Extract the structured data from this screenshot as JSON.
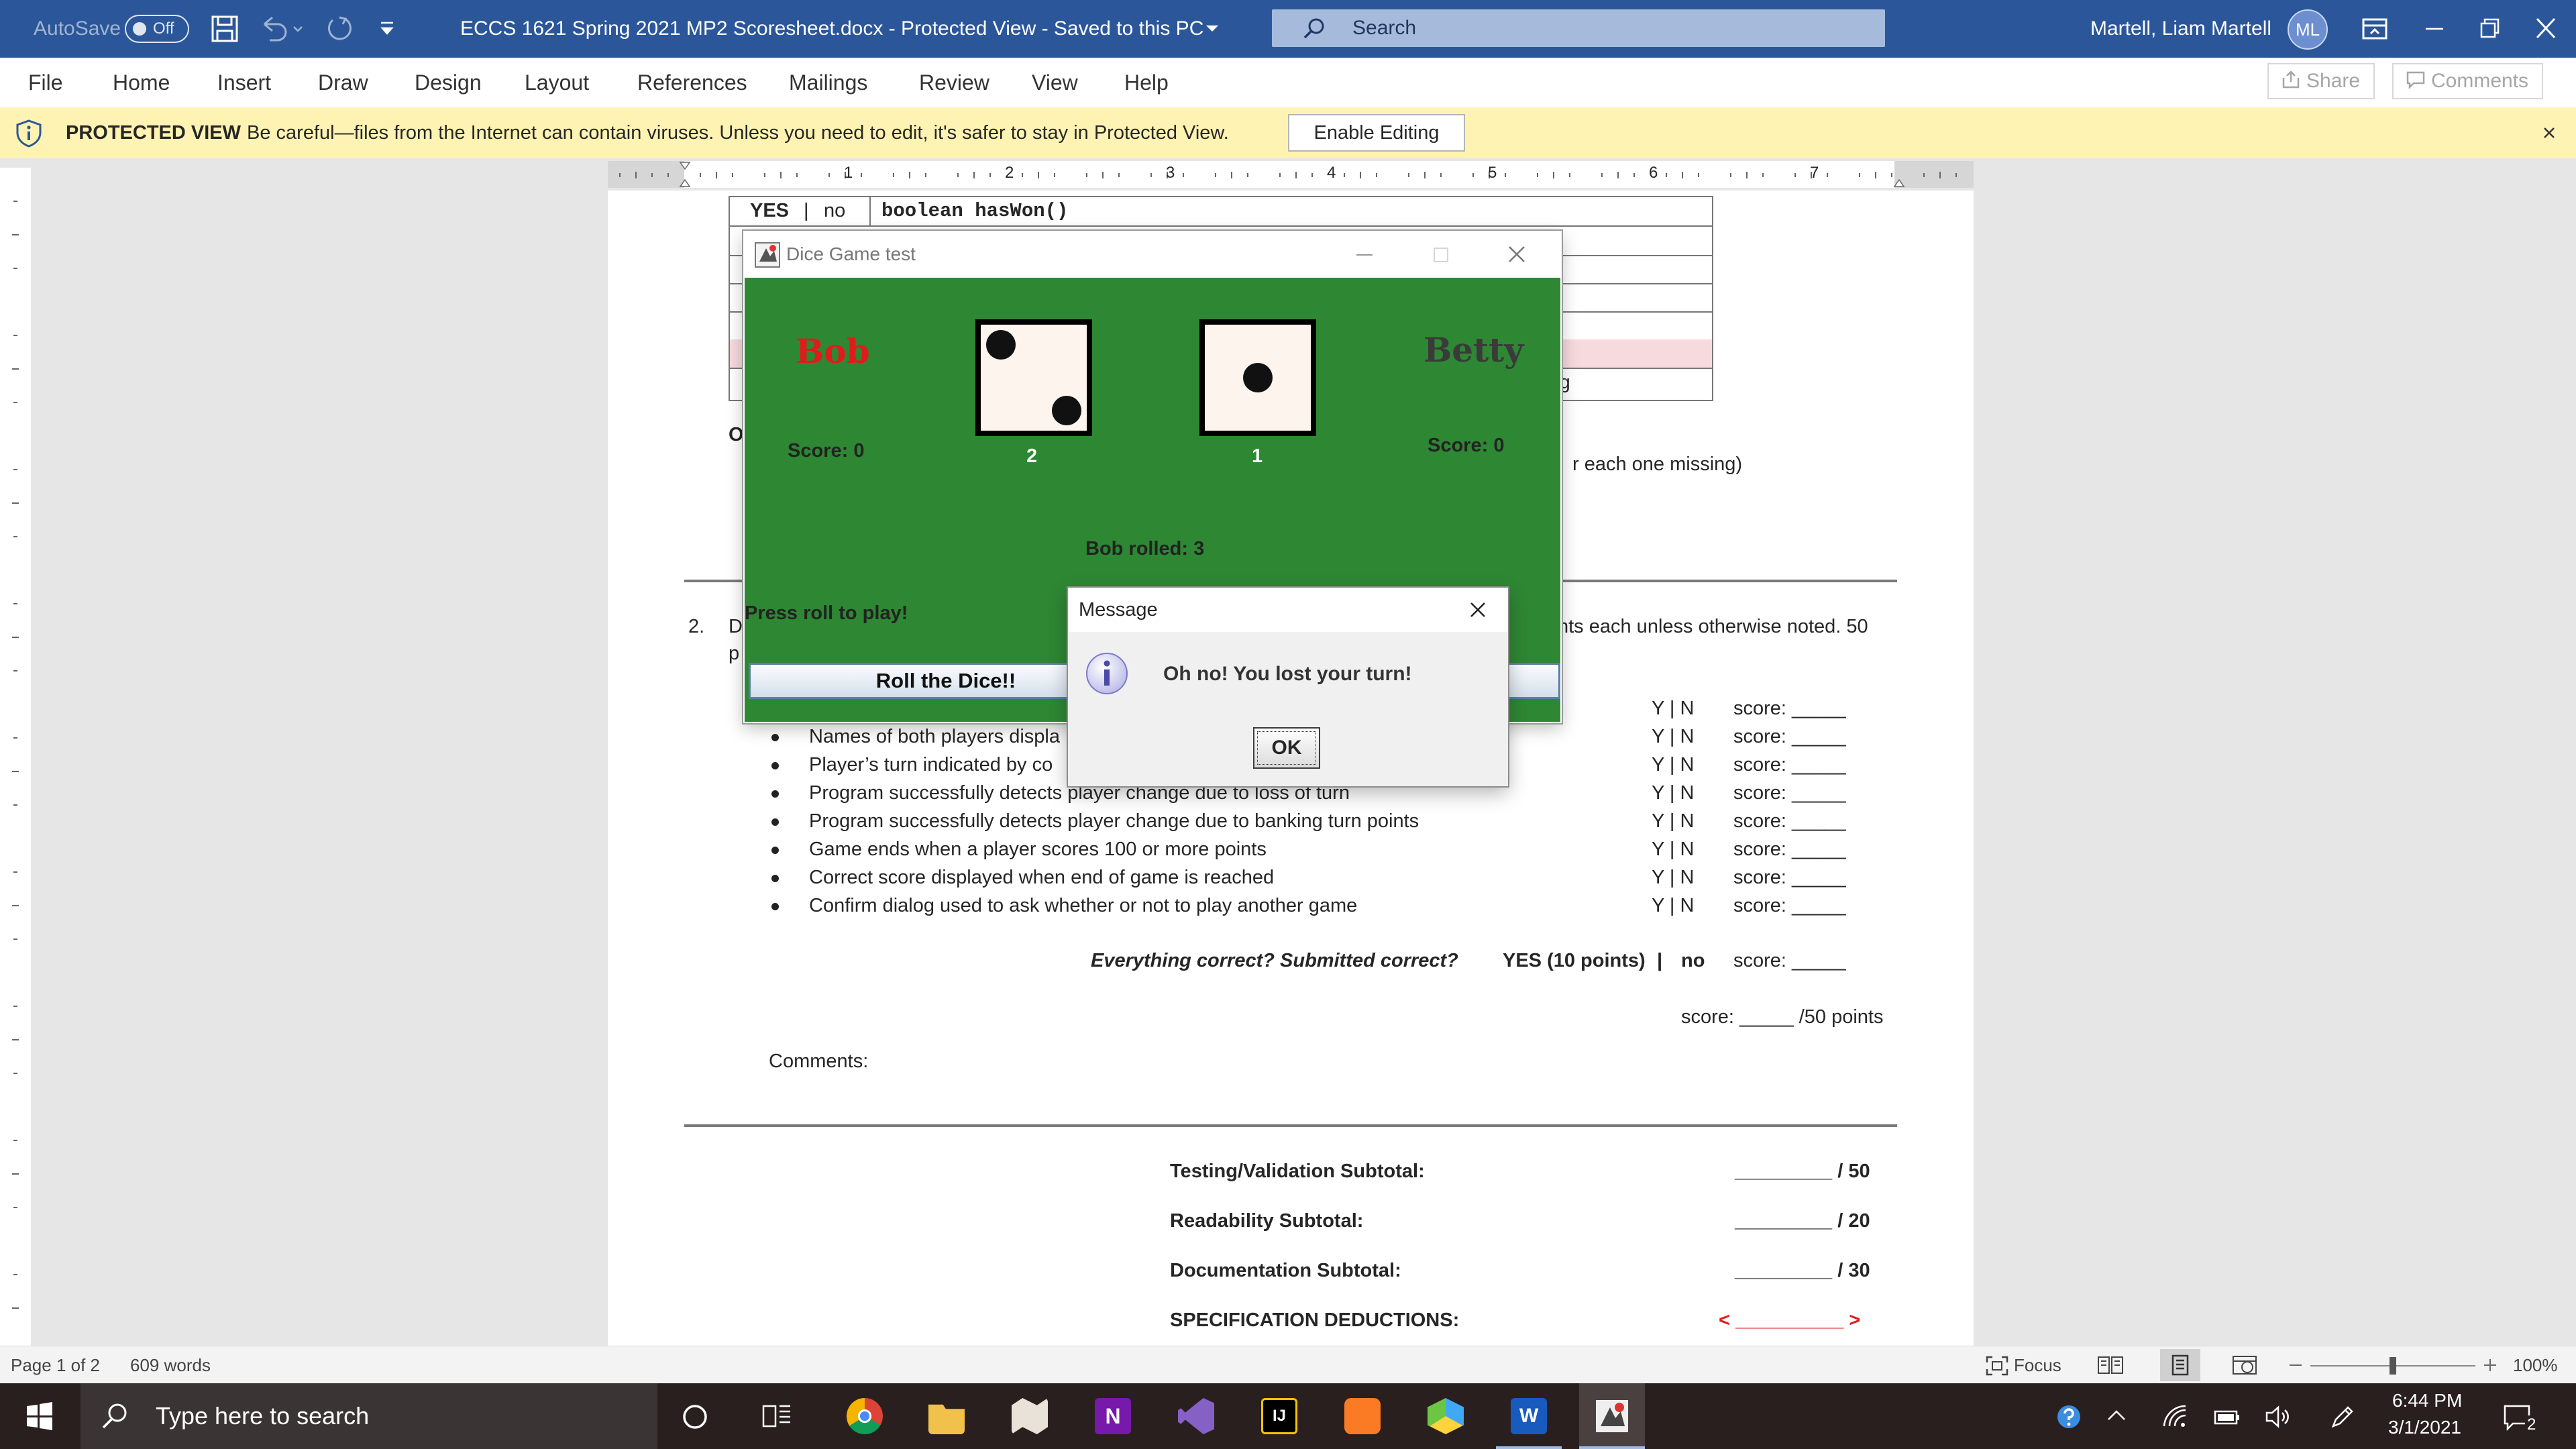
{
  "titlebar": {
    "autosave_label": "AutoSave",
    "autosave_state": "Off",
    "title": "ECCS 1621 Spring 2021 MP2 Scoresheet.docx  -  Protected View  -  Saved to this PC",
    "search_placeholder": "Search",
    "user_name": "Martell, Liam Martell",
    "user_initials": "ML",
    "accent_color": "#2b579a"
  },
  "ribbon": {
    "tabs": [
      "File",
      "Home",
      "Insert",
      "Draw",
      "Design",
      "Layout",
      "References",
      "Mailings",
      "Review",
      "View",
      "Help"
    ],
    "share_label": "Share",
    "comments_label": "Comments"
  },
  "protected_bar": {
    "title": "PROTECTED VIEW",
    "message": "Be careful—files from the Internet can contain viruses. Unless you need to edit, it's safer to stay in Protected View.",
    "enable_button": "Enable Editing"
  },
  "ruler": {
    "numbers": [
      "1",
      "2",
      "3",
      "4",
      "5",
      "6",
      "7"
    ]
  },
  "document": {
    "table_row": {
      "yes": "YES",
      "sep": "|",
      "no": "no",
      "method": "boolean hasWon()"
    },
    "clipped_row_text": "ing",
    "clipped_o": "O",
    "clipped_missing": "r each one missing)",
    "section2_num": "2.",
    "section2_start": "D",
    "section2_second": "p",
    "section2_tail": "nts each unless otherwise noted. 50",
    "items": [
      {
        "text": "",
        "yn": "Y | N",
        "score": "score: _____"
      },
      {
        "text": "Names of both players displa",
        "yn": "Y | N",
        "score": "score: _____"
      },
      {
        "text": "Player’s turn indicated by co",
        "yn": "Y | N",
        "score": "score: _____"
      },
      {
        "text": "Program successfully detects player change due to loss of turn",
        "yn": "Y | N",
        "score": "score: _____"
      },
      {
        "text": "Program successfully detects player change due to banking turn points",
        "yn": "Y | N",
        "score": "score: _____"
      },
      {
        "text": "Game ends when a player scores 100 or more points",
        "yn": "Y | N",
        "score": "score: _____"
      },
      {
        "text": "Correct score displayed when end of game is reached",
        "yn": "Y | N",
        "score": "score: _____"
      },
      {
        "text": "Confirm dialog used to ask whether or not to play another game",
        "yn": "Y | N",
        "score": "score: _____"
      }
    ],
    "everything_correct": "Everything correct? Submitted correct?",
    "yes_points": "YES (10 points)",
    "pipe": "|",
    "no": "no",
    "everything_score": "score: _____",
    "total_score": "score: _____ /50 points",
    "comments_label": "Comments:",
    "subtotals": [
      {
        "label": "Testing/Validation Subtotal:",
        "value": "_________ / 50"
      },
      {
        "label": "Readability Subtotal:",
        "value": "_________ / 20"
      },
      {
        "label": "Documentation Subtotal:",
        "value": "_________ / 30"
      }
    ],
    "deductions_label": "SPECIFICATION DEDUCTIONS:",
    "deductions_value": "< __________ >"
  },
  "dice_window": {
    "title": "Dice Game test",
    "player1": "Bob",
    "player2": "Betty",
    "player1_color": "#e01b1b",
    "player2_color": "#3a3a3a",
    "score1": "Score: 0",
    "score2": "Score: 0",
    "die1_value": "2",
    "die2_value": "1",
    "rolled_text": "Bob rolled: 3",
    "prompt": "Press roll to play!",
    "roll_button": "Roll the Dice!!",
    "background_color": "#2e8733"
  },
  "message_dialog": {
    "title": "Message",
    "text": "Oh no! You lost your turn!",
    "ok_button": "OK"
  },
  "statusbar": {
    "page": "Page 1 of 2",
    "words": "609 words",
    "focus": "Focus",
    "zoom": "100%"
  },
  "taskbar": {
    "search_placeholder": "Type here to search",
    "time": "6:44 PM",
    "date": "3/1/2021",
    "notification_count": "2"
  }
}
